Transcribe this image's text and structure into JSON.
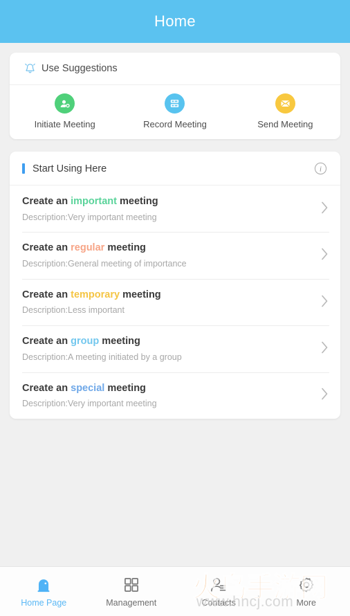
{
  "header": {
    "title": "Home",
    "background": "#5bc2f0",
    "title_color": "#ffffff"
  },
  "suggestions": {
    "icon": "alarm-bell-icon",
    "title": "Use Suggestions",
    "actions": [
      {
        "icon": "initiate-meeting-icon",
        "label": "Initiate Meeting",
        "color": "#4fd07a"
      },
      {
        "icon": "record-meeting-icon",
        "label": "Record Meeting",
        "color": "#58c3ef"
      },
      {
        "icon": "send-meeting-icon",
        "label": "Send Meeting",
        "color": "#f6c councils"
      }
    ]
  },
  "start_using": {
    "title": "Start Using Here",
    "accent_color": "#3f9ef0",
    "info_icon": "info-circle-icon",
    "rows": [
      {
        "prefix": "Create an ",
        "keyword": "important",
        "suffix": " meeting",
        "keyword_color": "#5ad39a",
        "description": "Description:Very important meeting",
        "chevron": "chevron-right-icon"
      },
      {
        "prefix": "Create an ",
        "keyword": "regular",
        "suffix": " meeting",
        "keyword_color": "#f7a486",
        "description": "Description:General meeting of importance",
        "chevron": "chevron-right-icon"
      },
      {
        "prefix": "Create an ",
        "keyword": "temporary",
        "suffix": " meeting",
        "keyword_color": "#f5c544",
        "description": "Description:Less important",
        "chevron": "chevron-right-icon"
      },
      {
        "prefix": "Create an ",
        "keyword": "group",
        "suffix": " meeting",
        "keyword_color": "#72c7ee",
        "description": "Description:A meeting initiated by a group",
        "chevron": "chevron-right-icon"
      },
      {
        "prefix": "Create an ",
        "keyword": "special",
        "suffix": " meeting",
        "keyword_color": "#6fa8e8",
        "description": "Description:Very important meeting",
        "chevron": "chevron-right-icon"
      }
    ]
  },
  "tabbar": {
    "active_color": "#5bb8f5",
    "inactive_color": "#6e6e6e",
    "tabs": [
      {
        "icon": "home-icon",
        "label": "Home Page",
        "active": true
      },
      {
        "icon": "grid-icon",
        "label": "Management",
        "active": false
      },
      {
        "icon": "contacts-icon",
        "label": "Contacts",
        "active": false
      },
      {
        "icon": "gear-icon",
        "label": "More",
        "active": false
      }
    ]
  },
  "watermark": {
    "text_cn": "火鸟手游网",
    "text_url": "www.hncj.com",
    "color": "#f4a04e"
  }
}
